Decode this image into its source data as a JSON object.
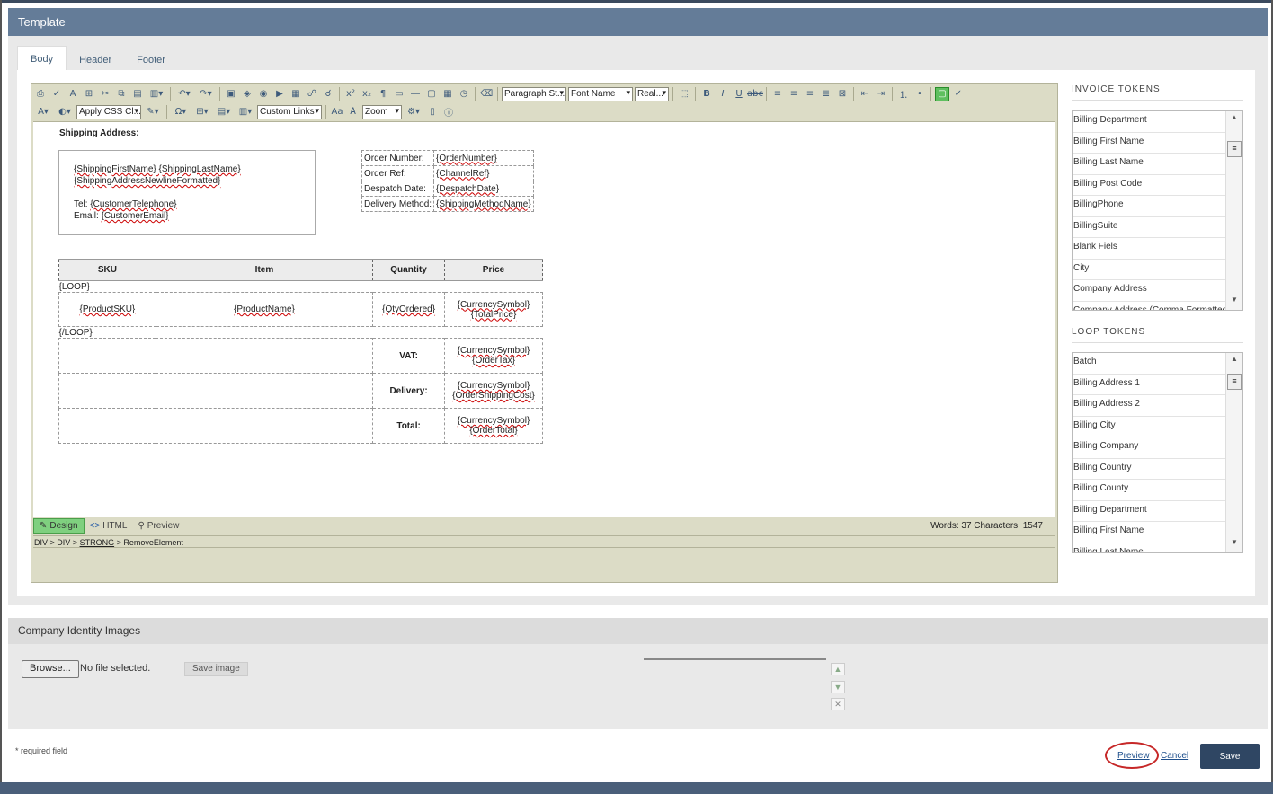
{
  "template_panel": {
    "title": "Template"
  },
  "tabs": [
    {
      "label": "Body"
    },
    {
      "label": "Header"
    },
    {
      "label": "Footer"
    }
  ],
  "toolbar": {
    "paragraph_style": "Paragraph St...",
    "font_name": "Font Name",
    "font_size": "Real...",
    "css_class": "Apply CSS Cl...",
    "custom_links": "Custom Links",
    "zoom": "Zoom"
  },
  "canvas": {
    "shipping_title": "Shipping Address:",
    "ship_line1": "{ShippingFirstName} {ShippingLastName}",
    "ship_line2": "{ShippingAddressNewlineFormatted}",
    "tel_label": "Tel: ",
    "tel_token": "{CustomerTelephone}",
    "email_label": "Email: ",
    "email_token": "{CustomerEmail}",
    "order_rows": [
      {
        "label": "Order Number:",
        "token": "{OrderNumber}"
      },
      {
        "label": "Order Ref:",
        "token": "{ChannelRef}"
      },
      {
        "label": "Despatch Date:",
        "token": "{DespatchDate}"
      },
      {
        "label": "Delivery Method:",
        "token": "{ShippingMethodName}"
      }
    ],
    "headers": {
      "sku": "SKU",
      "item": "Item",
      "quantity": "Quantity",
      "price": "Price"
    },
    "loop_start": "{LOOP}",
    "loop_end": "{/LOOP}",
    "row": {
      "sku": "{ProductSKU}",
      "name": "{ProductName}",
      "qty": "{QtyOrdered}",
      "currency": "{CurrencySymbol}",
      "price": "{TotalPrice}"
    },
    "totals": [
      {
        "label": "VAT:",
        "currency": "{CurrencySymbol}",
        "value": "{OrderTax}"
      },
      {
        "label": "Delivery:",
        "currency": "{CurrencySymbol}",
        "value": "{OrderShippingCost}"
      },
      {
        "label": "Total:",
        "currency": "{CurrencySymbol}",
        "value": "{OrderTotal}"
      }
    ]
  },
  "editor_footer": {
    "design": "Design",
    "html": "HTML",
    "preview": "Preview",
    "word_count": "Words: 37  Characters: 1547",
    "crumbs": [
      "DIV",
      "DIV",
      "STRONG",
      "RemoveElement"
    ],
    "crumb_sep": " > "
  },
  "invoice_tokens": {
    "title": "INVOICE TOKENS",
    "items": [
      "Billing Department",
      "Billing First Name",
      "Billing Last Name",
      "Billing Post Code",
      "BillingPhone",
      "BillingSuite",
      "Blank Fiels",
      "City",
      "Company Address",
      "Company Address (Comma Formatted)"
    ]
  },
  "loop_tokens": {
    "title": "LOOP TOKENS",
    "items": [
      "Batch",
      "Billing Address 1",
      "Billing Address 2",
      "Billing City",
      "Billing Company",
      "Billing Country",
      "Billing County",
      "Billing Department",
      "Billing First Name",
      "Billing Last Name"
    ]
  },
  "company_identity": {
    "title": "Company Identity Images",
    "browse": "Browse...",
    "no_file": "No file selected.",
    "save_image": "Save image"
  },
  "footer": {
    "required": "* required field",
    "preview": "Preview",
    "cancel": "Cancel",
    "save": "Save"
  },
  "colors": {
    "header": "#647c98",
    "save_button": "#2f4663",
    "annotation_ring": "#c62828"
  }
}
